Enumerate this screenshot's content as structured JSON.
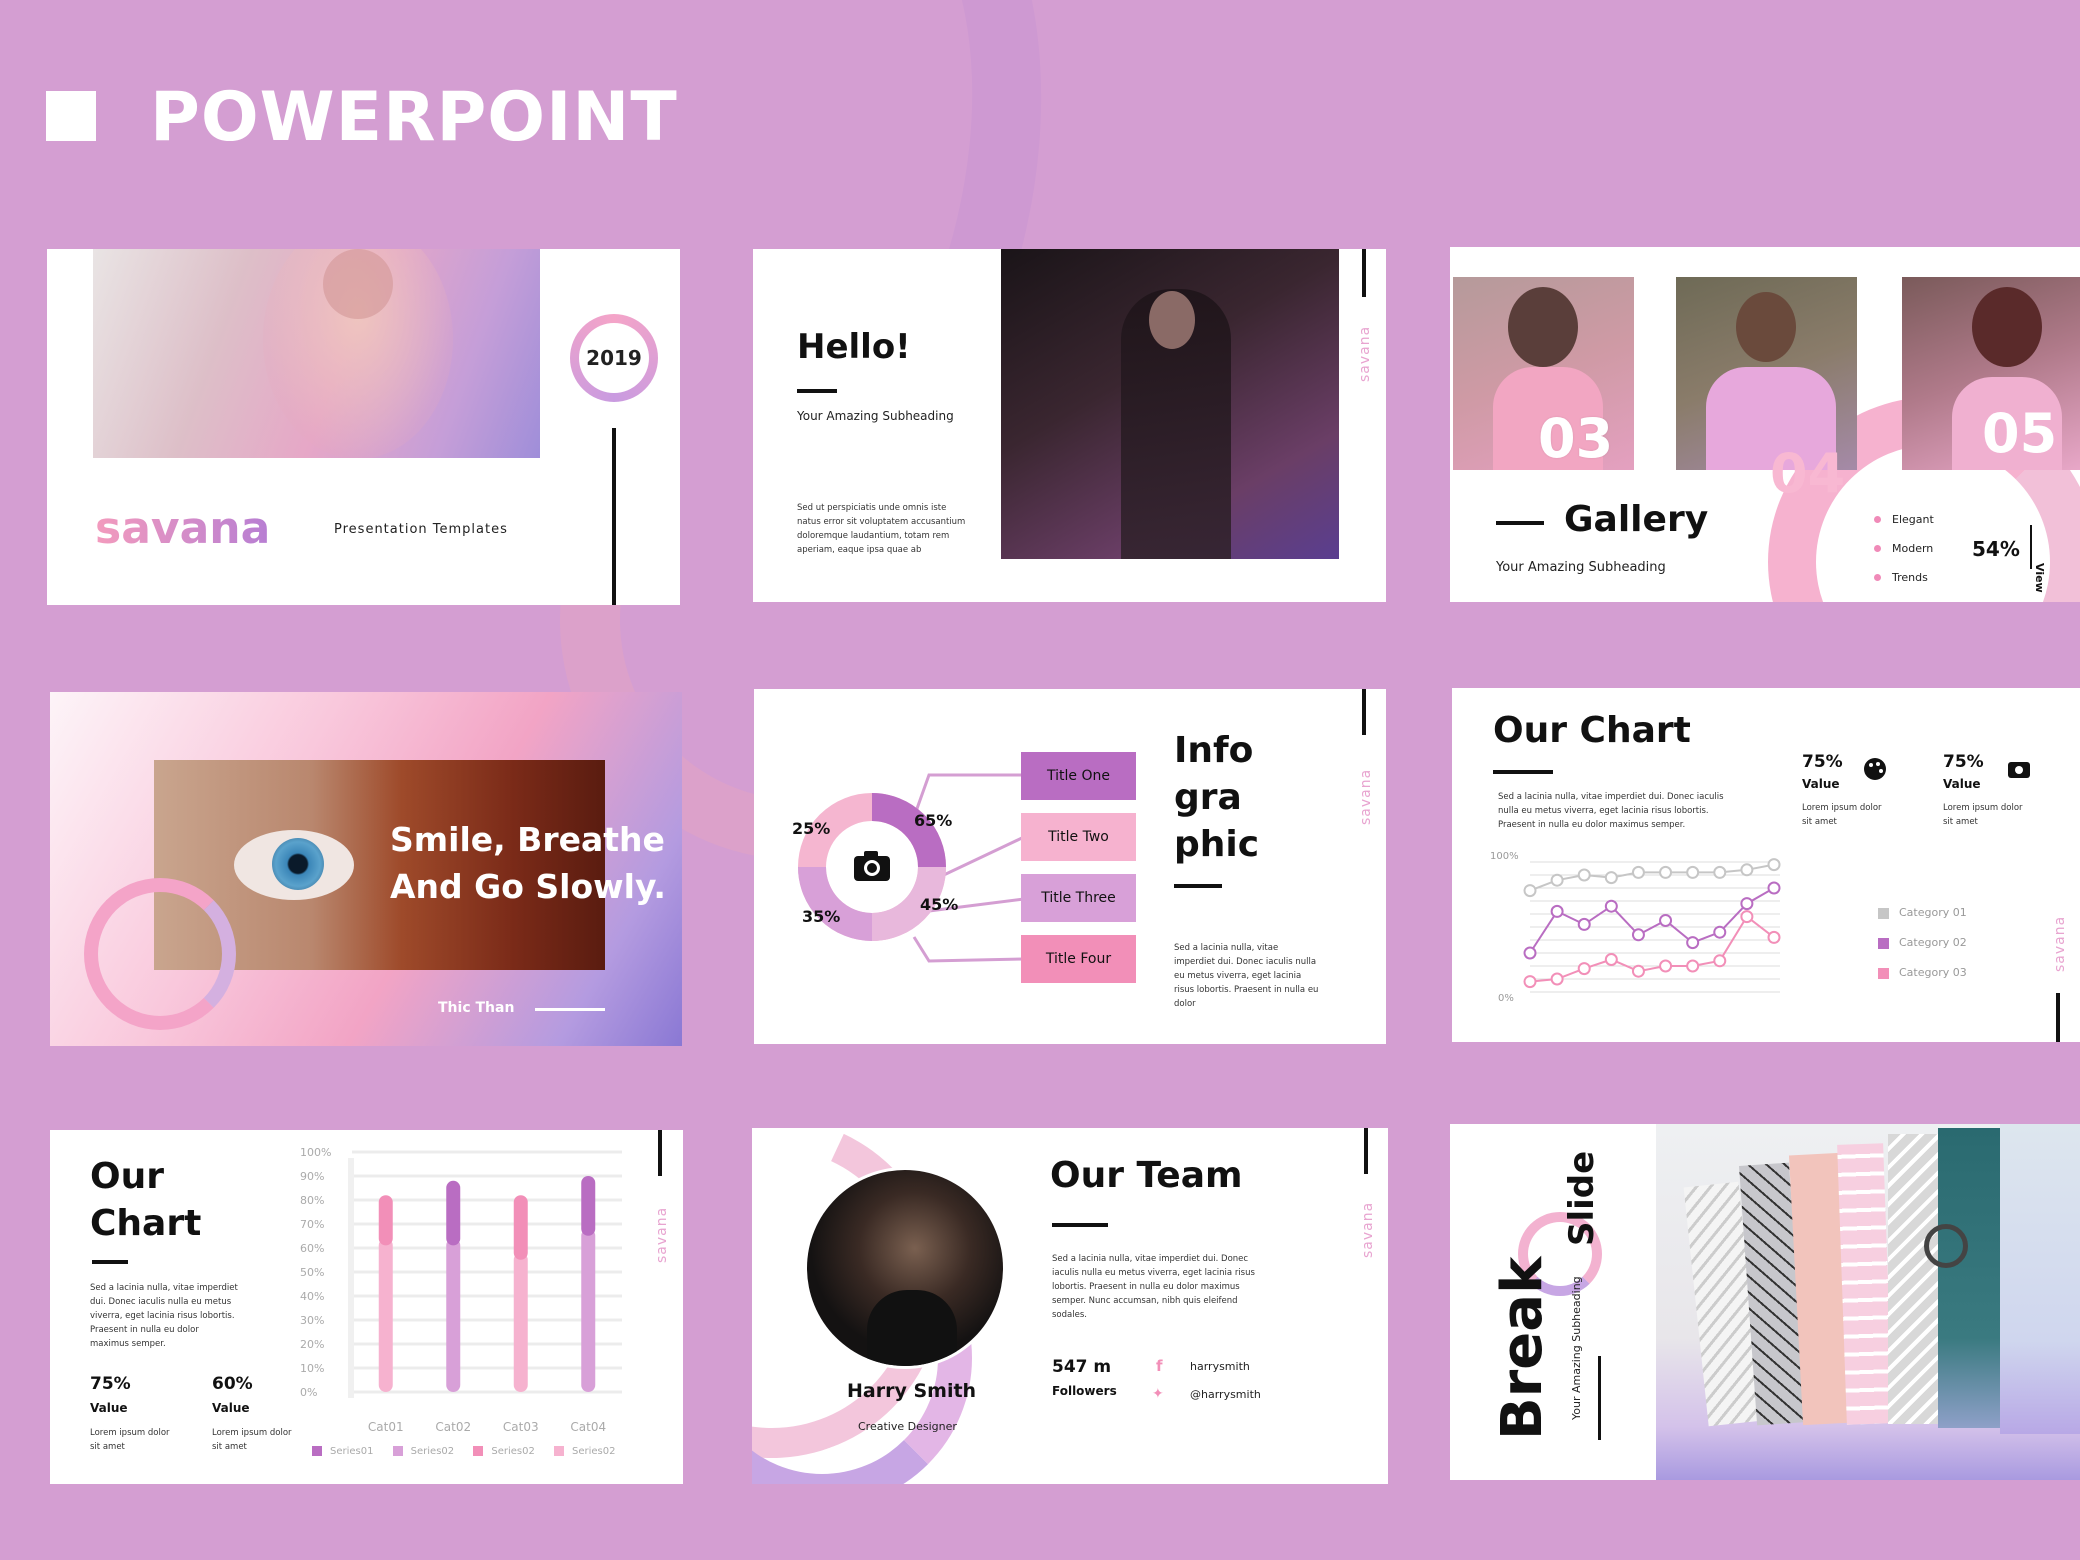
{
  "header": {
    "title": "POWERPOINT"
  },
  "colors": {
    "background": "#d49ed2",
    "pink": "#f28fb8",
    "purple": "#b96dc2",
    "violet": "#8d74d6",
    "light_pink": "#f6b2cf"
  },
  "slide1": {
    "year": "2019",
    "brand": "savana",
    "tagline": "Presentation Templates"
  },
  "slide2": {
    "title": "Hello!",
    "subheading": "Your Amazing Subheading",
    "body": "Sed ut perspiciatis unde omnis iste natus error sit voluptatem accusantium doloremque laudantium, totam rem aperiam, eaque ipsa quae ab",
    "brand_vertical": "savana"
  },
  "slide3": {
    "numbers": [
      "03",
      "04",
      "05"
    ],
    "title": "Gallery",
    "subheading": "Your Amazing Subheading",
    "list": [
      "Elegant",
      "Modern",
      "Trends"
    ],
    "percent": "54%",
    "view": "View"
  },
  "slide4": {
    "quote_line1": "Smile, Breathe",
    "quote_line2": "And Go Slowly.",
    "author": "Thic Than"
  },
  "slide5": {
    "title_lines": [
      "Info",
      "gra",
      "phic"
    ],
    "percents": [
      "25%",
      "65%",
      "35%",
      "45%"
    ],
    "titles": [
      "Title One",
      "Title Two",
      "Title Three",
      "Title Four"
    ],
    "body": "Sed a lacinia nulla, vitae imperdiet dui. Donec iaculis nulla eu metus viverra, eget lacinia risus lobortis. Praesent in nulla eu dolor",
    "brand_vertical": "savana"
  },
  "slide6": {
    "title": "Our Chart",
    "body": "Sed a lacinia nulla, vitae imperdiet dui. Donec iaculis nulla eu metus viverra, eget lacinia risus lobortis. Praesent in nulla eu dolor maximus semper.",
    "stats": [
      {
        "value": "75%",
        "label": "Value",
        "desc": "Lorem ipsum dolor sit amet",
        "icon": "palette-icon"
      },
      {
        "value": "75%",
        "label": "Value",
        "desc": "Lorem ipsum dolor sit amet",
        "icon": "camera-icon"
      }
    ],
    "y_top": "100%",
    "y_bottom": "0%",
    "legend": [
      "Category 01",
      "Category 02",
      "Category 03"
    ],
    "brand_vertical": "savana"
  },
  "slide7": {
    "title_line1": "Our",
    "title_line2": "Chart",
    "body": "Sed a lacinia nulla, vitae imperdiet dui. Donec iaculis nulla eu metus viverra, eget lacinia risus lobortis. Praesent in nulla eu dolor maximus semper.",
    "stats": [
      {
        "value": "75%",
        "label": "Value",
        "desc": "Lorem ipsum dolor sit amet"
      },
      {
        "value": "60%",
        "label": "Value",
        "desc": "Lorem ipsum dolor sit amet"
      }
    ],
    "y_ticks": [
      "100%",
      "90%",
      "80%",
      "70%",
      "60%",
      "50%",
      "40%",
      "30%",
      "20%",
      "10%",
      "0%"
    ],
    "categories": [
      "Cat01",
      "Cat02",
      "Cat03",
      "Cat04"
    ],
    "legend": [
      "Series01",
      "Series02",
      "Series02",
      "Series02"
    ],
    "brand_vertical": "savana"
  },
  "slide8": {
    "title": "Our Team",
    "body": "Sed a lacinia nulla, vitae imperdiet dui. Donec iaculis nulla eu metus viverra, eget lacinia risus lobortis. Praesent in nulla eu dolor maximus semper. Nunc accumsan, nibh quis eleifend sodales.",
    "followers_count": "547 m",
    "followers_label": "Followers",
    "name": "Harry Smith",
    "role": "Creative Designer",
    "facebook": "harrysmith",
    "twitter": "@harrysmith",
    "brand_vertical": "savana"
  },
  "slide9": {
    "title_break": "Break",
    "title_slide": "Slide",
    "subheading": "Your Amazing Subheading"
  },
  "chart_data": [
    {
      "type": "line",
      "x": [
        1,
        2,
        3,
        4,
        5,
        6,
        7,
        8,
        9,
        10
      ],
      "ylim": [
        0,
        100
      ],
      "series": [
        {
          "name": "Category 01",
          "values": [
            78,
            86,
            90,
            88,
            92,
            92,
            92,
            92,
            94,
            98
          ]
        },
        {
          "name": "Category 02",
          "values": [
            30,
            62,
            52,
            66,
            44,
            55,
            38,
            46,
            68,
            80
          ]
        },
        {
          "name": "Category 03",
          "values": [
            8,
            10,
            18,
            25,
            16,
            20,
            20,
            24,
            58,
            42
          ]
        }
      ]
    },
    {
      "type": "bar",
      "categories": [
        "Cat01",
        "Cat02",
        "Cat03",
        "Cat04"
      ],
      "ylim": [
        0,
        100
      ],
      "series": [
        {
          "name": "Series01",
          "values": [
            82,
            88,
            82,
            90
          ]
        },
        {
          "name": "Series02",
          "values": [
            18,
            24,
            24,
            22
          ]
        }
      ]
    }
  ]
}
